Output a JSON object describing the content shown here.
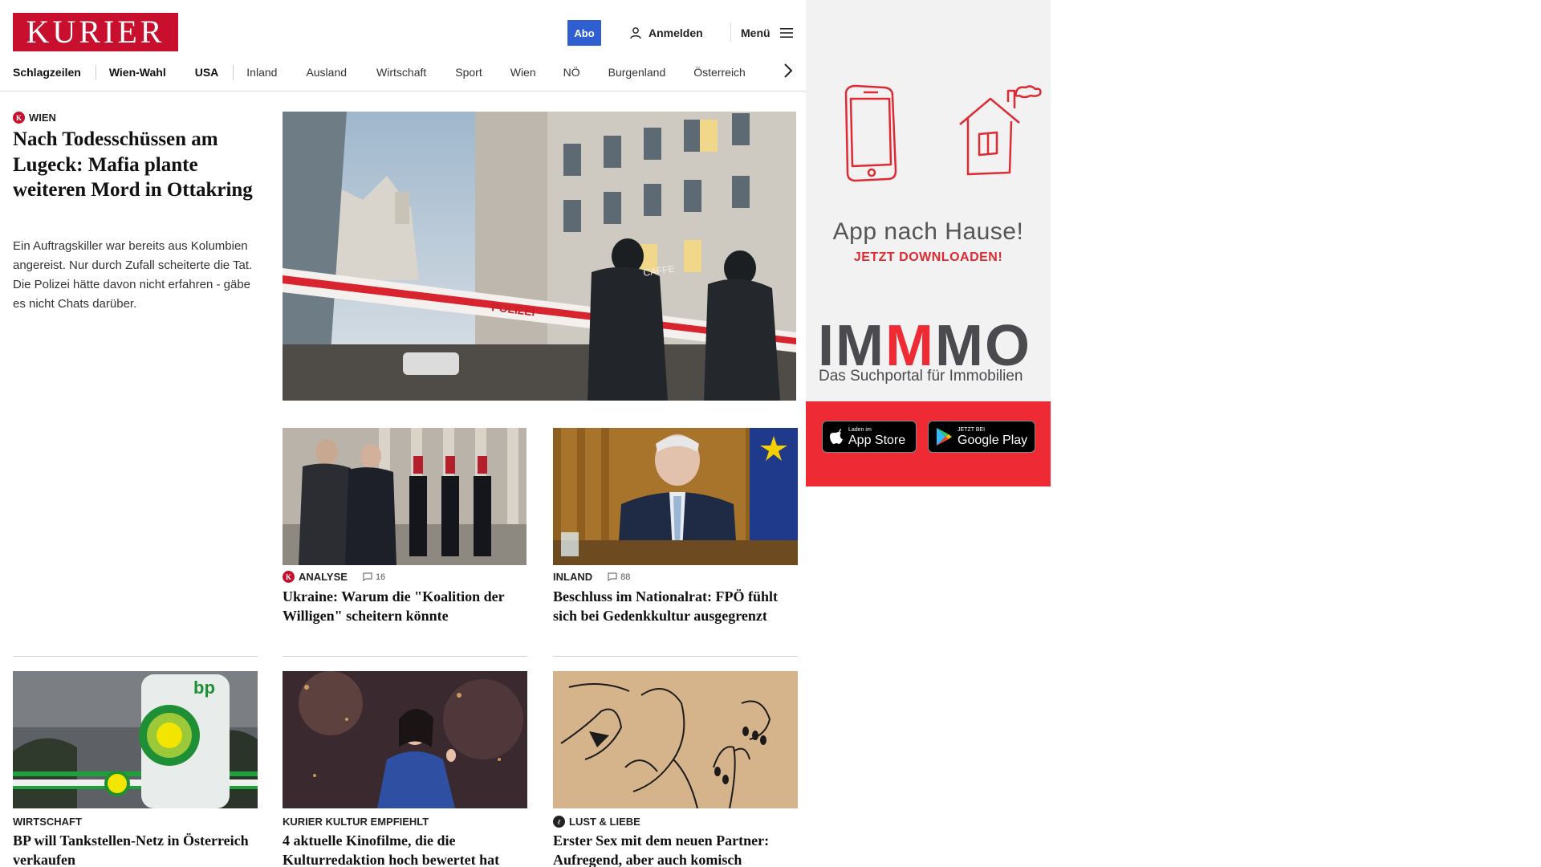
{
  "header": {
    "logo_text": "KURIER",
    "abo_label": "Abo",
    "login_label": "Anmelden",
    "menu_label": "Menü",
    "accent_color": "#c8102e"
  },
  "nav": {
    "items": [
      "Schlagzeilen",
      "Wien-Wahl",
      "USA",
      "Inland",
      "Ausland",
      "Wirtschaft",
      "Sport",
      "Wien",
      "NÖ",
      "Burgenland",
      "Österreich"
    ]
  },
  "lead": {
    "kicker": "WIEN",
    "title": "Nach Todesschüssen am Lugeck: Mafia plante weiteren Mord in Ottakring",
    "teaser": "Ein Auftragskiller war bereits aus Kolumbien angereist. Nur durch Zufall scheiterte die Tat. Die Polizei hätte davon nicht erfahren - gäbe es nicht Chats darüber.",
    "image_alt": "Polizisten hinter Absperrband in der Wiener Innenstadt",
    "tape_text": "POLIZEI"
  },
  "cards": [
    {
      "kicker": "ANALYSE",
      "comments": "16",
      "title": "Ukraine: Warum die \"Koalition der Willigen\" scheitern könnte"
    },
    {
      "kicker": "INLAND",
      "comments": "88",
      "title": "Beschluss im Nationalrat: FPÖ fühlt sich bei Gedenkkultur ausgegrenzt"
    },
    {
      "kicker": "WIRTSCHAFT",
      "title": "BP will Tankstellen-Netz in Österreich verkaufen"
    },
    {
      "kicker": "KURIER KULTUR EMPFIEHLT",
      "title": "4 aktuelle Kinofilme, die die Kulturredaktion hoch bewertet hat"
    },
    {
      "kicker": "LUST & LIEBE",
      "title": "Erster Sex mit dem neuen Partner: Aufregend, aber auch komisch"
    }
  ],
  "ad": {
    "headline": "App nach Hause!",
    "subline": "JETZT DOWNLOADEN!",
    "brand_a": "IM",
    "brand_m": "M",
    "brand_b": "MO",
    "tagline": "Das Suchportal für Immobilien",
    "appstore_small": "Laden im",
    "appstore_big": "App Store",
    "play_small": "JETZT BEI",
    "play_big": "Google Play"
  },
  "image_texts": {
    "bp_logo": "bp",
    "caffe_sign": "CAFFE"
  }
}
